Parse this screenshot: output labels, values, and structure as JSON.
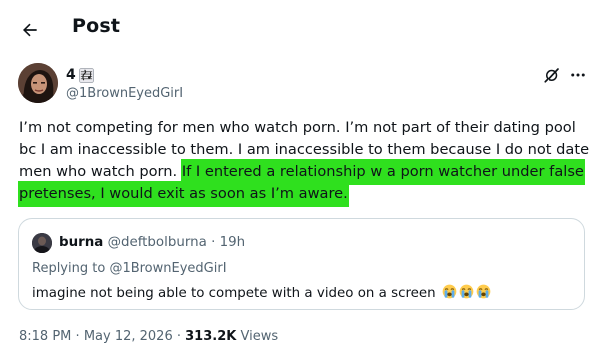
{
  "header": {
    "title": "Post"
  },
  "author": {
    "display_name": "4",
    "handle": "@1BrownEyedGirI"
  },
  "tweet": {
    "lines": [
      {
        "plain": "I’m not competing for men who watch porn. I’m not part of their dating pool",
        "hl": ""
      },
      {
        "plain": "bc I am inaccessible to them. I am inaccessible to them because I do not date",
        "hl": ""
      },
      {
        "plain": "men who watch porn. ",
        "hl": "If I entered a relationship w a porn watcher under false"
      },
      {
        "plain": "",
        "hl": "pretenses, I would exit as soon as I’m aware."
      }
    ]
  },
  "quote": {
    "name": "burna",
    "handle": "@deftbolburna",
    "separator": "·",
    "time": "19h",
    "replying_prefix": "Replying to ",
    "replying_handle": "@1BrownEyedGirI",
    "text": "imagine not being able to compete with a video on a screen"
  },
  "meta": {
    "time": "8:18 PM",
    "separator": "·",
    "date": "May 12, 2026",
    "views_count": "313.2K",
    "views_label": "Views"
  },
  "icons": {
    "back": "arrow-left-icon",
    "grok": "grok-icon",
    "more": "more-dots-icon",
    "name_emoji": "musical-score-emoji",
    "crying": "loudly-crying-face-emoji"
  },
  "colors": {
    "highlight": "#2fe01e",
    "muted": "#536471",
    "border": "#cfd9de"
  }
}
